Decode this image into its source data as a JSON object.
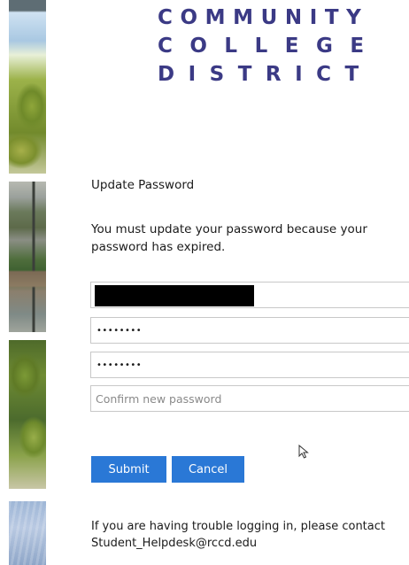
{
  "logo": {
    "line1": "COMMUNITY",
    "line2": "COLLEGE",
    "line3": "DISTRICT",
    "color": "#3b3a85"
  },
  "form": {
    "heading": "Update Password",
    "message": "You must update your password because your password has expired.",
    "username_value": "",
    "old_password_value": "••••••••",
    "new_password_value": "••••••••",
    "confirm_placeholder": "Confirm new password"
  },
  "buttons": {
    "submit_label": "Submit",
    "cancel_label": "Cancel",
    "color": "#2a78d6"
  },
  "help": {
    "line1": "If you are having trouble logging in, please contact",
    "line2": "Student_Helpdesk@rccd.edu"
  },
  "icons": {
    "cursor": "mouse-pointer-icon"
  }
}
